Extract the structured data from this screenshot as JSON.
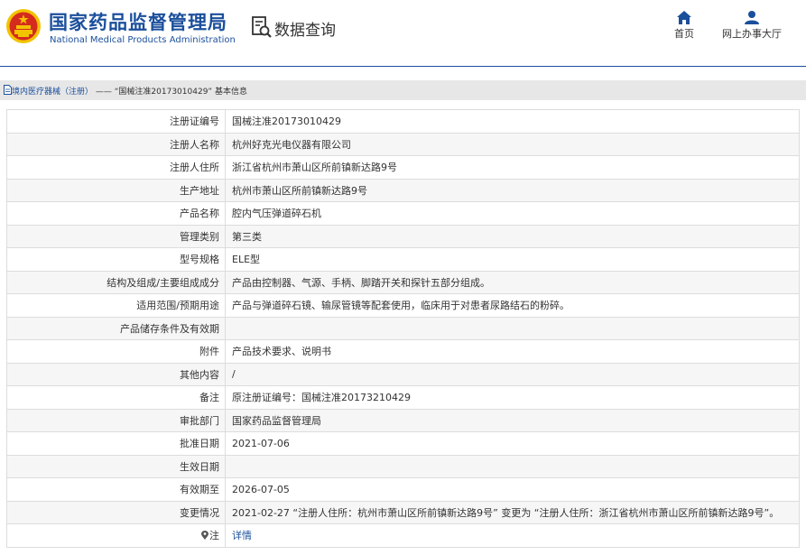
{
  "header": {
    "logo_cn": "国家药品监督管理局",
    "logo_en": "National Medical Products Administration",
    "query_title": "数据查询",
    "nav": [
      {
        "label": "首页",
        "icon": "home-icon"
      },
      {
        "label": "网上办事大厅",
        "icon": "user-icon"
      }
    ]
  },
  "breadcrumb": {
    "section": "境内医疗器械（注册）",
    "separator": "——",
    "record": "“国械注准20173010429”",
    "suffix": "基本信息"
  },
  "rows": [
    {
      "label": "注册证编号",
      "value": "国械注准20173010429"
    },
    {
      "label": "注册人名称",
      "value": "杭州好克光电仪器有限公司"
    },
    {
      "label": "注册人住所",
      "value": "浙江省杭州市萧山区所前镇新达路9号"
    },
    {
      "label": "生产地址",
      "value": "杭州市萧山区所前镇新达路9号"
    },
    {
      "label": "产品名称",
      "value": "腔内气压弹道碎石机"
    },
    {
      "label": "管理类别",
      "value": "第三类"
    },
    {
      "label": "型号规格",
      "value": "ELE型"
    },
    {
      "label": "结构及组成/主要组成成分",
      "value": "产品由控制器、气源、手柄、脚踏开关和探针五部分组成。"
    },
    {
      "label": "适用范围/预期用途",
      "value": "产品与弹道碎石镜、输尿管镜等配套使用，临床用于对患者尿路结石的粉碎。"
    },
    {
      "label": "产品储存条件及有效期",
      "value": ""
    },
    {
      "label": "附件",
      "value": "产品技术要求、说明书"
    },
    {
      "label": "其他内容",
      "value": "/"
    },
    {
      "label": "备注",
      "value": "原注册证编号：国械注准20173210429"
    },
    {
      "label": "审批部门",
      "value": "国家药品监督管理局"
    },
    {
      "label": "批准日期",
      "value": "2021-07-06"
    },
    {
      "label": "生效日期",
      "value": ""
    },
    {
      "label": "有效期至",
      "value": "2026-07-05"
    },
    {
      "label": "变更情况",
      "value": "2021-02-27 “注册人住所：杭州市萧山区所前镇新达路9号” 变更为 “注册人住所：浙江省杭州市萧山区所前镇新达路9号”。"
    },
    {
      "label": "注",
      "value": "详情",
      "icon": "pin-icon"
    }
  ],
  "colors": {
    "brand_blue": "#1b4f9c",
    "emblem_red": "#d52b1e",
    "emblem_gold": "#f2c300",
    "crumb_bg": "#e7e7e7"
  }
}
